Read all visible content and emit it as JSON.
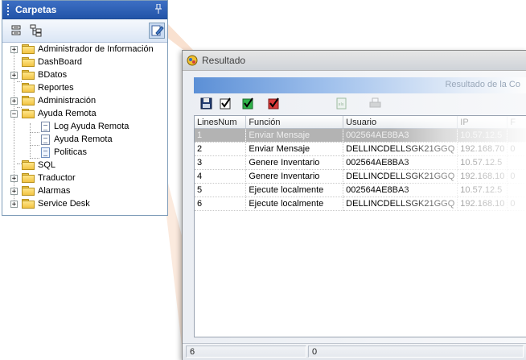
{
  "carpetas": {
    "title": "Carpetas",
    "tree": [
      {
        "label": "Administrador de Información",
        "expander": "+"
      },
      {
        "label": "DashBoard",
        "expander": ""
      },
      {
        "label": "BDatos",
        "expander": "+"
      },
      {
        "label": "Reportes",
        "expander": ""
      },
      {
        "label": "Administración",
        "expander": "+"
      },
      {
        "label": "Ayuda Remota",
        "expander": "−"
      },
      {
        "label": "Log Ayuda Remota",
        "expander": ""
      },
      {
        "label": "Ayuda Remota",
        "expander": ""
      },
      {
        "label": "Politicas",
        "expander": ""
      },
      {
        "label": "SQL",
        "expander": ""
      },
      {
        "label": "Traductor",
        "expander": "+"
      },
      {
        "label": "Alarmas",
        "expander": "+"
      },
      {
        "label": "Service Desk",
        "expander": "+"
      }
    ]
  },
  "window": {
    "title": "Resultado",
    "band_text": "Resultado de la Co",
    "columns": [
      "LinesNum",
      "Función",
      "Usuario",
      "IP",
      "F"
    ],
    "rows": [
      [
        "1",
        "Enviar Mensaje",
        "002564AE8BA3",
        "10.57.12.5",
        ""
      ],
      [
        "2",
        "Enviar Mensaje",
        "DELLINCDELLSGK21GGQ",
        "192.168.70",
        "0"
      ],
      [
        "3",
        "Genere Inventario",
        "002564AE8BA3",
        "10.57.12.5",
        ""
      ],
      [
        "4",
        "Genere Inventario",
        "DELLINCDELLSGK21GGQ",
        "192.168.10",
        "0"
      ],
      [
        "5",
        "Ejecute localmente",
        "002564AE8BA3",
        "10.57.12.5",
        ""
      ],
      [
        "6",
        "Ejecute localmente",
        "DELLINCDELLSGK21GGQ",
        "192.168.10",
        "0"
      ]
    ],
    "status": [
      "6",
      "0"
    ]
  },
  "colors": {
    "header_blue": "#2254a8",
    "selected_row": "#b3b3b3",
    "connector": "#f7d9c4"
  }
}
